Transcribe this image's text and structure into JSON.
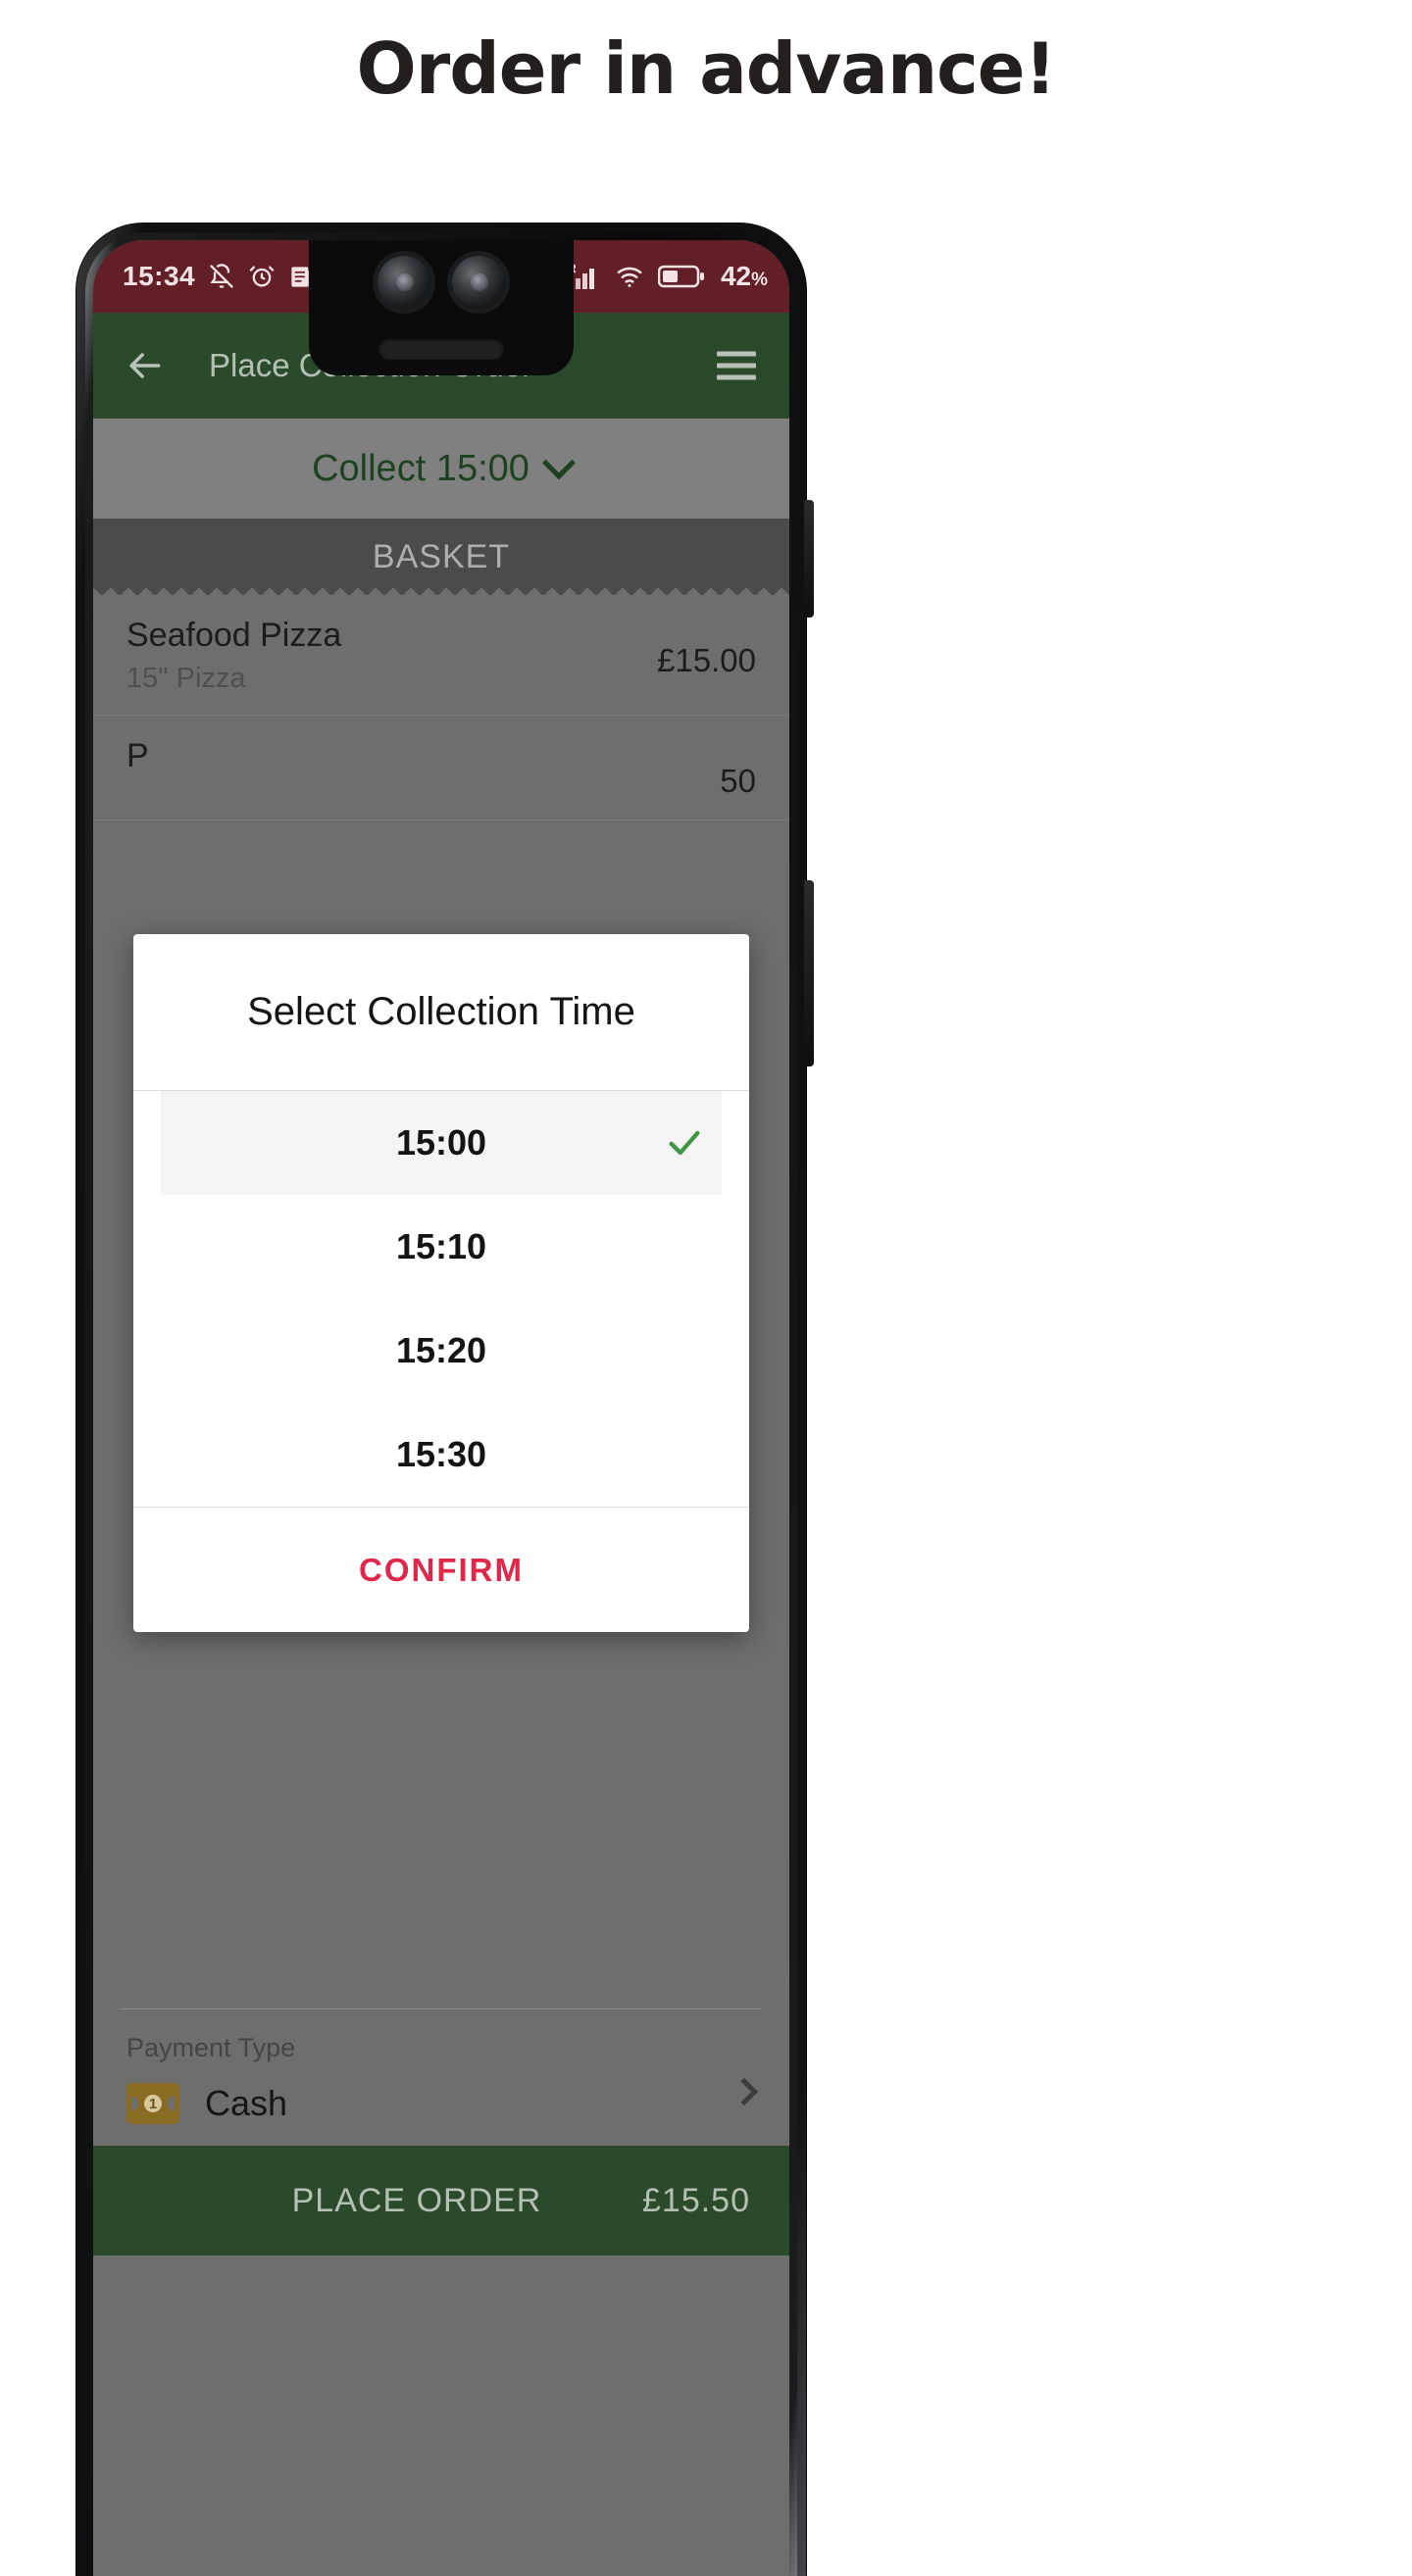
{
  "headline": "Order in advance!",
  "status_bar": {
    "time": "15:34",
    "battery_percent": "42",
    "battery_percent_symbol": "%",
    "left_icons": [
      "bell-off-icon",
      "alarm-clock-icon",
      "news-document-icon",
      "trash-icon"
    ],
    "right_icons": [
      "location-arrow-icon",
      "roaming-signal-icon",
      "wifi-icon",
      "battery-icon"
    ],
    "roaming_label": "R",
    "background_color": "#631f28"
  },
  "app_bar": {
    "title": "Place Collection Order",
    "back_icon": "back-arrow-icon",
    "menu_icon": "hamburger-menu-icon",
    "background_color": "#2b4a2c"
  },
  "collect_bar": {
    "label": "Collect 15:00",
    "chevron_icon": "chevron-down-icon",
    "text_color": "#1d4220"
  },
  "basket": {
    "header": "BASKET",
    "items": [
      {
        "name": "Seafood Pizza",
        "description": "15\" Pizza",
        "price": "£15.00"
      },
      {
        "name": "P",
        "description": "",
        "price": "50"
      }
    ]
  },
  "payment": {
    "label": "Payment Type",
    "value": "Cash",
    "icon": "cash-banknote-icon",
    "note_symbol": "1",
    "chevron_icon": "chevron-right-icon"
  },
  "place_order": {
    "label": "PLACE ORDER",
    "total": "£15.50"
  },
  "dialog": {
    "title": "Select Collection Time",
    "times": [
      {
        "label": "15:00",
        "selected": true
      },
      {
        "label": "15:10",
        "selected": false
      },
      {
        "label": "15:20",
        "selected": false
      },
      {
        "label": "15:30",
        "selected": false
      }
    ],
    "check_icon": "check-icon",
    "check_color": "#3f9644",
    "confirm_label": "CONFIRM",
    "confirm_color": "#e0274a"
  }
}
